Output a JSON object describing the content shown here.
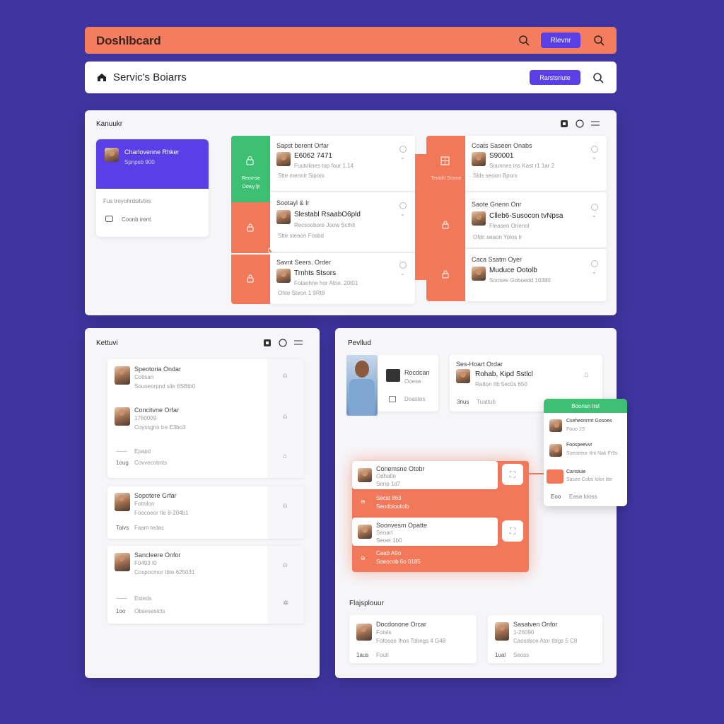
{
  "header": {
    "title": "Doshlbcard",
    "button_label": "Rlevnr"
  },
  "subheader": {
    "title": "Servic's Boiarrs",
    "button_label": "Rarstsriute"
  },
  "kanban": {
    "title": "Kanuukr",
    "profile": {
      "name": "Charlovenne Rhker",
      "sub": "Spnpsb 900"
    },
    "side_text": "Fus troyohrdsitvtes",
    "side_link": "Coonb irent",
    "col1": {
      "tabs": [
        {
          "label": "Reovrse Dowy ljt"
        }
      ],
      "cards": [
        {
          "heading": "Sapst berent Orfar",
          "name": "E6062 7471",
          "detail": "Fuutolines top four 1.14",
          "meta": "Stte   mennir Sipors"
        },
        {
          "heading": "Sootayl & Ir",
          "name": "Slestabl RsaabO6pld",
          "detail": "Recsoobore Joow Scthlt",
          "meta": "Stte   steaon Fosbd"
        },
        {
          "heading": "Savnt Seers. Order",
          "name": "Trnhts Stsors",
          "detail": "Fotaohne hor Atne. 20t01",
          "meta": "Ohte   Steon 1 9Rt8"
        }
      ]
    },
    "col2": {
      "tabs": [
        {
          "label": "Tevtdrl Srome"
        }
      ],
      "cards": [
        {
          "heading": "Coats Saseen Onabs",
          "name": "S90001",
          "detail": "Sounnes ins Kast r1 1ar 2",
          "meta": "Slds   seoon Bpors"
        },
        {
          "heading": "Saote Gnenn Onr",
          "name": "Clleb6-Susocon tvNpsa",
          "detail": "Fleasen Orienol",
          "meta": "Ofdc   seaon Yolos lr"
        },
        {
          "heading": "Caca Ssatm Oyer",
          "name": "Muduce Ootolb",
          "detail": "Soosee Goboedd 10380",
          "meta": ""
        }
      ]
    }
  },
  "list_panel": {
    "title": "Kettuvi",
    "groups": [
      {
        "rows": [
          {
            "title": "Speotoria Ondar",
            "sub": "Cotisan",
            "detail": "Souoeorpnd sile 6SBtb0"
          },
          {
            "title": "Concitvne Orfar",
            "sub": "1760009",
            "detail": "Coyssgno tre E3bo3"
          }
        ],
        "footer": [
          {
            "label": "Epapd",
            "prefix": ""
          },
          {
            "label": "Covvecobnts",
            "prefix": "1oug"
          }
        ]
      },
      {
        "rows": [
          {
            "title": "Sopotere Grfar",
            "sub": "Fotnilon",
            "detail": "Foocoeor Ite 8-204b1"
          }
        ],
        "footer": [
          {
            "label": "Faam tedac",
            "prefix": "Taivs"
          }
        ]
      },
      {
        "rows": [
          {
            "title": "Sancleere Onfor",
            "sub": "F0493 I0",
            "detail": "Coxpocmor Ibte 625031"
          }
        ],
        "footer": [
          {
            "label": "Esteds",
            "prefix": ""
          },
          {
            "label": "Obsesesicts",
            "prefix": "1oo"
          }
        ]
      }
    ]
  },
  "detail_panel": {
    "title": "Pevllud",
    "top_left": {
      "label": "Rocdcan",
      "sub": "Ooese",
      "action": "Doastes"
    },
    "top_right": {
      "heading": "Ses-Hoart Ordar",
      "name": "Rohab, Kipd Sstlcl",
      "detail": "Ratton Itb 5ec0s 650",
      "meta_a": "3nus",
      "meta_b": "Tuattub"
    },
    "flow": [
      {
        "title": "Conemsne Otobr",
        "sub": "Odhalte",
        "extra": "Senp 1d7",
        "band": "Secst 863",
        "band_sub": "Seodbiootolb"
      },
      {
        "title": "Soonvesm Opatte",
        "sub": "Seoarl",
        "extra": "Seoet 1b0",
        "band": "Caab A9o",
        "band_sub": "Soeocob 6o 0185"
      }
    ],
    "popup": {
      "header": "Boonsn lrsl",
      "items": [
        {
          "title": "Cseheonrrnt Gosoes",
          "sub": "Fouo 2S"
        },
        {
          "title": "Foospeevvr",
          "sub": "Soeoeeor Itnt Nak Fr9s"
        },
        {
          "title": "Cansiuie",
          "sub": "Sasee Cobs Iolor itte"
        }
      ],
      "footer_a": "Eoo",
      "footer_b": "Easa Idoss"
    },
    "section_title": "Flajsplouur",
    "bottom": [
      {
        "title": "Docdonone Orcar",
        "sub": "Fotsls",
        "detail": "Fofosoe Ihos Tobngs 4 G48",
        "tag": "1aus",
        "tag2": "Fouti"
      },
      {
        "title": "Sasatven Onfor",
        "sub": "1-26090",
        "detail": "Caosdsce Ator tblgs 5 C8",
        "tag": "1ual",
        "tag2": "Seoss"
      }
    ]
  },
  "colors": {
    "background": "#3f35a0",
    "accent": "#5b3fe6",
    "orange": "#f2785a",
    "green": "#3dc073",
    "header_orange": "#f57d5f"
  },
  "icons": [
    "home-icon",
    "search-icon",
    "zoom-icon",
    "lock-icon",
    "grid-icon",
    "circle-icon",
    "menu-icon",
    "bell-icon",
    "chevron-down-icon",
    "expand-icon",
    "link-icon"
  ]
}
